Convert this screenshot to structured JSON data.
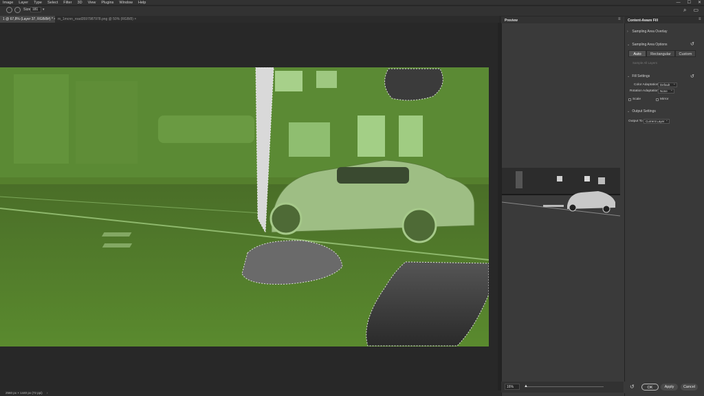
{
  "menu": {
    "items": [
      "Image",
      "Layer",
      "Type",
      "Select",
      "Filter",
      "3D",
      "View",
      "Plugins",
      "Window",
      "Help"
    ]
  },
  "window_controls": {
    "minimize": "—",
    "maximize": "☐",
    "close": "✕"
  },
  "options_bar": {
    "size_label": "Size:",
    "size_value": "181",
    "stepper": "▾",
    "search_icon": "⌕",
    "layout_icon": "▭"
  },
  "tabs": [
    {
      "label": "1 @ 67,8% (Layer 37, RGB/8#) *",
      "close": "×"
    },
    {
      "label": "m_1mcnn_road3597987978.png @ 50% (RGB/8)",
      "close": "×"
    }
  ],
  "status": {
    "text": "2560 px × 1440 px (72 ppi)",
    "arrow": "›"
  },
  "preview": {
    "title": "Preview",
    "menu_icon": "≡",
    "zoom": "16%"
  },
  "caf": {
    "title": "Content-Aware Fill",
    "menu_icon": "≡",
    "sampling_overlay": "Sampling Area Overlay",
    "sampling_options": "Sampling Area Options",
    "segments": [
      "Auto",
      "Rectangular",
      "Custom"
    ],
    "sample_all": "Sample All Layers",
    "fill_settings": "Fill Settings",
    "color_adaptation_label": "Color Adaptation",
    "color_adaptation_value": "Default",
    "rotation_adaptation_label": "Rotation Adaptation",
    "rotation_adaptation_value": "None",
    "scale_label": "Scale",
    "mirror_label": "Mirror",
    "output_settings": "Output Settings",
    "output_to_label": "Output To",
    "output_to_value": "Current Layer",
    "ok": "OK",
    "apply": "Apply",
    "cancel": "Cancel"
  },
  "colors": {
    "overlay_green": "#557f2d",
    "ui_dark": "#282828",
    "panel": "#393939"
  }
}
